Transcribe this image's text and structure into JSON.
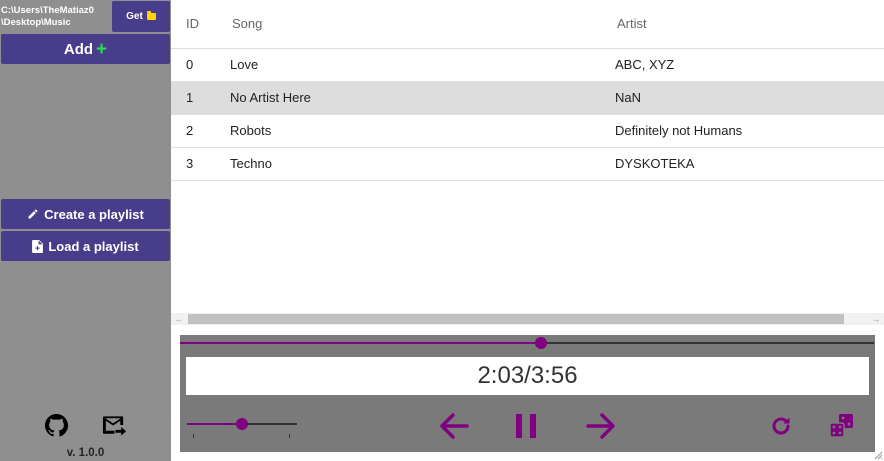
{
  "sidebar": {
    "path_line1": "C:\\Users\\TheMatiaz0",
    "path_line2": "\\Desktop\\Music",
    "get_label": "Get",
    "add_label": "Add",
    "create_playlist_label": "Create a playlist",
    "load_playlist_label": "Load a playlist",
    "version": "v. 1.0.0"
  },
  "table": {
    "columns": [
      "ID",
      "Song",
      "Artist"
    ],
    "rows": [
      {
        "id": "0",
        "song": "Love",
        "artist": "ABC, XYZ"
      },
      {
        "id": "1",
        "song": "No Artist Here",
        "artist": "NaN"
      },
      {
        "id": "2",
        "song": "Robots",
        "artist": "Definitely not Humans"
      },
      {
        "id": "3",
        "song": "Techno",
        "artist": "DYSKOTEKA"
      }
    ],
    "selected_row": 1
  },
  "player": {
    "time_display": "2:03/3:56",
    "progress_fraction": 0.52,
    "volume_fraction": 0.5
  },
  "colors": {
    "accent": "#800080",
    "button_bg": "#483d8b",
    "sidebar_bg": "#8f8f8f",
    "player_bg": "#7a7a7a",
    "plus_green": "#22e04a",
    "folder_yellow": "#ffd500"
  },
  "icons": {
    "folder": "folder-icon",
    "plus": "plus-icon",
    "pencil": "pencil-icon",
    "file_add": "file-add-icon",
    "github": "github-icon",
    "mail": "mail-forward-icon",
    "prev": "arrow-left-icon",
    "pause": "pause-icon",
    "next": "arrow-right-icon",
    "repeat": "repeat-icon",
    "shuffle": "dice-icon"
  }
}
